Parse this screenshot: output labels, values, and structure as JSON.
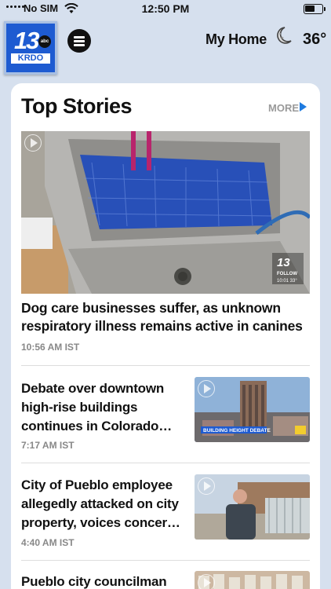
{
  "status_bar": {
    "carrier": "No SIM",
    "time": "12:50 PM"
  },
  "header": {
    "logo_number": "13",
    "logo_network": "abc",
    "logo_callsign": "KRDO",
    "location_label": "My Home",
    "temperature": "36°",
    "weather_icon": "moon-icon"
  },
  "section": {
    "title": "Top Stories",
    "more_label": "MORE"
  },
  "stories": [
    {
      "headline": "Dog care businesses suffer, as unknown respiratory illness remains active in canines",
      "time": "10:56 AM IST",
      "thumbnail_caption": "FOLLOW",
      "thumbnail_clock": "10:01 33°"
    },
    {
      "headline": "Debate over downtown high-rise buildings continues in Colorado…",
      "time": "7:17 AM IST",
      "thumbnail_caption": "BUILDING HEIGHT DEBATE"
    },
    {
      "headline": "City of Pueblo employee allegedly attacked on city property, voices concer…",
      "time": "4:40 AM IST"
    },
    {
      "headline": "Pueblo city councilman"
    }
  ],
  "colors": {
    "background": "#d6e0ee",
    "brand_blue": "#1e5bd1",
    "accent_arrow": "#1e7be0"
  }
}
